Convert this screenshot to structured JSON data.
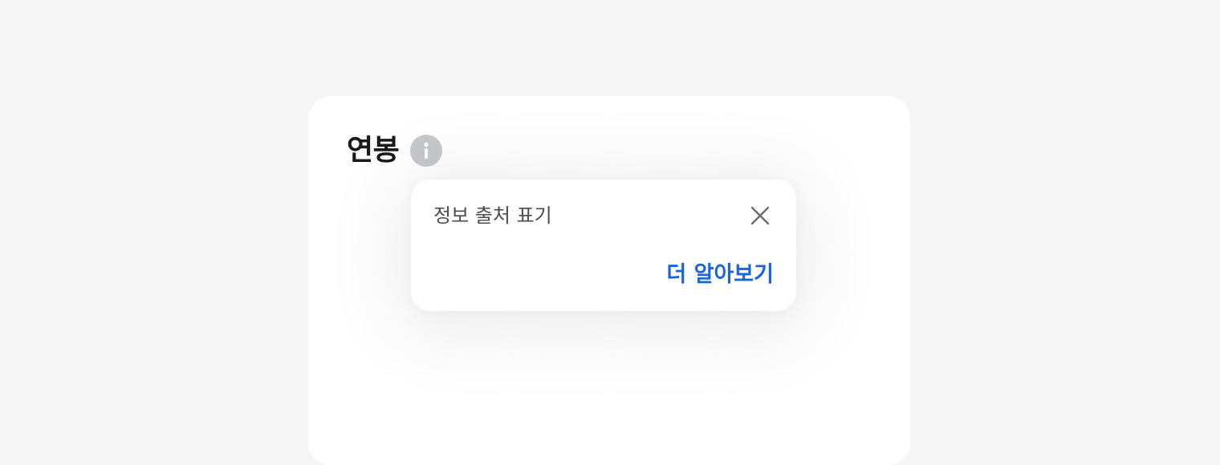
{
  "card": {
    "title": "연봉"
  },
  "info_button": {
    "icon": "info-icon"
  },
  "popover": {
    "text": "정보 출처 표기",
    "close_icon": "close-icon",
    "link_label": "더 알아보기"
  },
  "colors": {
    "page_background": "#f6f6f6",
    "card_background": "#ffffff",
    "title_text": "#1a1a1a",
    "info_icon_bg": "#c7c8cb",
    "popover_text": "#4b4b4b",
    "link": "#1b64da"
  }
}
